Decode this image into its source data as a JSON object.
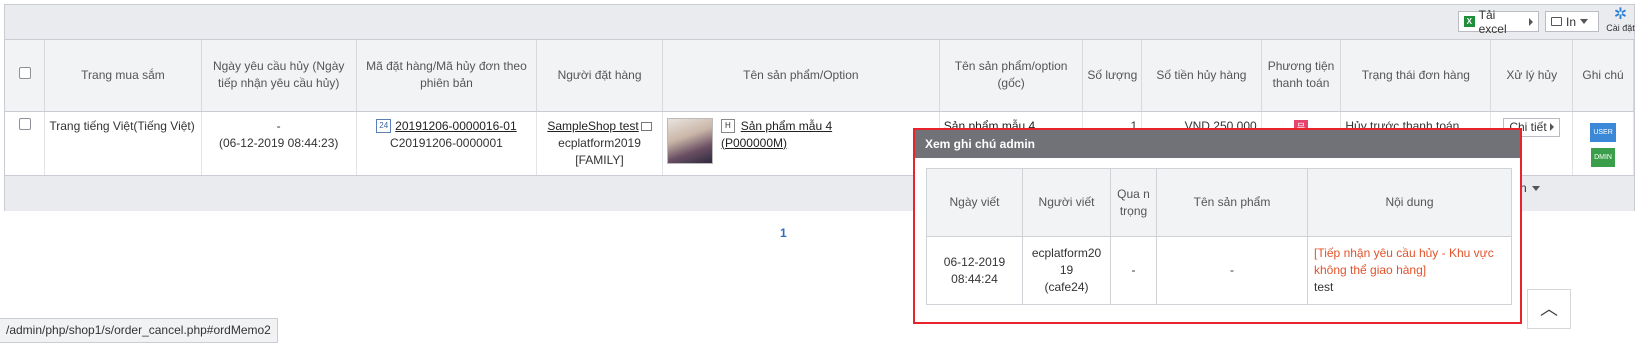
{
  "toolbar": {
    "excel_label": "Tải excel",
    "print_label": "In",
    "settings_label": "Cài đặt"
  },
  "columns": [
    "Trang mua sắm",
    "Ngày yêu cầu hủy (Ngày tiếp nhận yêu cầu hủy)",
    "Mã đặt hàng/Mã hủy đơn theo phiên bản",
    "Người đặt hàng",
    "Tên sản phẩm/Option",
    "Tên sản phẩm/option (gốc)",
    "Số lượng",
    "Số tiền hủy hàng",
    "Phương tiện thanh toán",
    "Trạng thái đơn hàng",
    "Xử lý hủy",
    "Ghi chú"
  ],
  "row": {
    "shop": "Trang tiếng Việt(Tiếng Việt)",
    "request_date": "-",
    "received_date": "(06-12-2019 08:44:23)",
    "order_badge": "24",
    "order_no": "20191206-0000016-01",
    "cancel_no": "C20191206-0000001",
    "buyer_name": "SampleShop test",
    "buyer_id": "ecplatform2019",
    "buyer_group": "[FAMILY]",
    "product_badge": "H",
    "product_name": "Sản phẩm mẫu 4",
    "product_code": "(P000000M)",
    "product_origin": "Sản phẩm mẫu 4",
    "quantity": "1",
    "amount": "VND 250,000",
    "pay_icon": "무",
    "status": "Hủy trước thanh toán",
    "detail_label": "Chi tiết",
    "tag_user": "USER",
    "tag_admin": "DMIN"
  },
  "pager": {
    "current": "1"
  },
  "lang_select": "n",
  "popup": {
    "title": "Xem ghi chú admin",
    "headers": [
      "Ngày viết",
      "Người viết",
      "Qua n trọng",
      "Tên sản phẩm",
      "Nội dung"
    ],
    "date": "06-12-2019",
    "time": "08:44:24",
    "writer_1": "ecplatform20",
    "writer_2": "19",
    "writer_3": "(cafe24)",
    "importance": "-",
    "product": "-",
    "content_red": "[Tiếp nhận yêu cầu hủy - Khu vực không thể giao hàng]",
    "content": "test"
  },
  "status_url": "/admin/php/shop1/s/order_cancel.php#ordMemo2",
  "scroll_top_icon": "chevron-up"
}
